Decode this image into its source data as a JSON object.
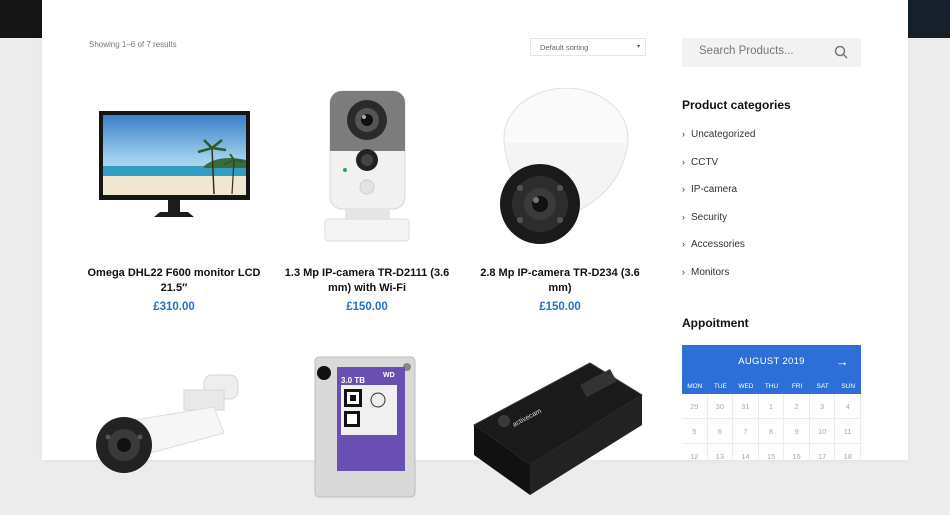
{
  "shop": {
    "result_count": "Showing 1–6 of 7 results",
    "sort_selected": "Default sorting",
    "sort_caret": "▾"
  },
  "products": [
    {
      "title": "Omega DHL22 F600 monitor LCD 21.5″",
      "price": "£310.00"
    },
    {
      "title": "1.3 Mp IP-camera TR-D2111 (3.6 mm) with Wi-Fi",
      "price": "£150.00"
    },
    {
      "title": "2.8 Mp IP-camera TR-D234 (3.6 mm)",
      "price": "£150.00"
    },
    {
      "title": "",
      "price": ""
    },
    {
      "title": "",
      "price": ""
    },
    {
      "title": "",
      "price": ""
    }
  ],
  "hdd_label": {
    "capacity": "3.0 TB",
    "brand": "WD"
  },
  "poe_label": "activecam",
  "sidebar": {
    "search_placeholder": "Search Products...",
    "categories_title": "Product categories",
    "categories": [
      "Uncategorized",
      "CCTV",
      "IP-camera",
      "Security",
      "Accessories",
      "Monitors"
    ],
    "appointment_title": "Appoitment",
    "calendar": {
      "month": "AUGUST 2019",
      "next_glyph": "→",
      "weekdays": [
        "MON",
        "TUE",
        "WED",
        "THU",
        "FRI",
        "SAT",
        "SUN"
      ],
      "days": [
        "29",
        "30",
        "31",
        "1",
        "2",
        "3",
        "4",
        "5",
        "6",
        "7",
        "8",
        "9",
        "10",
        "11",
        "12",
        "13",
        "14",
        "15",
        "16",
        "17",
        "18"
      ]
    }
  },
  "colors": {
    "accent": "#2d6fd6",
    "price": "#2670c9"
  }
}
